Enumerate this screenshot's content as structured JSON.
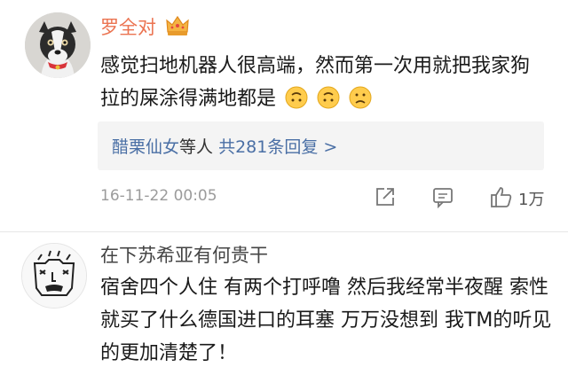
{
  "comments": [
    {
      "username": "罗全对",
      "crown_icon": "crown-vip-icon",
      "text_before_emoji": "感觉扫地机器人很高端，然而第一次用就把我家狗拉的屎涂得满地都是",
      "emojis": [
        "upside-down-smile-emoji",
        "upside-down-smile-emoji",
        "sad-face-emoji"
      ],
      "replies": {
        "names": "醋栗仙女",
        "middle": "等人",
        "count_text": "共281条回复",
        "chevron": ">"
      },
      "timestamp": "16-11-22 00:05",
      "actions": {
        "share_icon": "share-icon",
        "comment_icon": "comment-icon",
        "like_icon": "thumbs-up-icon",
        "like_count": "1万"
      }
    },
    {
      "username": "在下苏希亚有何贵干",
      "text": "宿舍四个人住 有两个打呼噜 然后我经常半夜醒 索性就买了什么德国进口的耳塞 万万没想到 我TM的听见的更加清楚了！"
    }
  ],
  "colors": {
    "username_orange": "#eb7350",
    "link_blue": "#4a6fa5",
    "muted_gray": "#9b9b9b",
    "reply_bg": "#f4f4f4"
  }
}
